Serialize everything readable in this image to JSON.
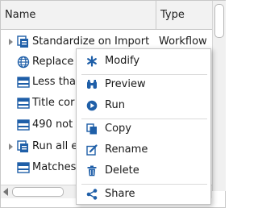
{
  "columns": {
    "name": "Name",
    "type": "Type"
  },
  "rows": [
    {
      "label": "Standardize on Import",
      "type": "Workflow",
      "icon": "workflow-icon",
      "expandable": true
    },
    {
      "label": "Replace",
      "type": "",
      "icon": "globe-icon",
      "expandable": false
    },
    {
      "label": "Less tha",
      "type": "",
      "icon": "rule-icon",
      "expandable": false
    },
    {
      "label": "Title cor",
      "type": "",
      "icon": "rule-icon",
      "expandable": false
    },
    {
      "label": "490 not",
      "type": "",
      "icon": "rule-icon",
      "expandable": false
    },
    {
      "label": "Run all e",
      "type": "",
      "icon": "workflow-icon",
      "expandable": true
    },
    {
      "label": "Matches",
      "type": "",
      "icon": "rule-icon",
      "expandable": false
    }
  ],
  "context_menu": {
    "items": [
      {
        "label": "Modify",
        "icon": "asterisk-icon"
      },
      {
        "label": "Preview",
        "icon": "binoculars-icon"
      },
      {
        "label": "Run",
        "icon": "play-circle-icon"
      },
      {
        "label": "Copy",
        "icon": "copy-icon"
      },
      {
        "label": "Rename",
        "icon": "edit-icon"
      },
      {
        "label": "Delete",
        "icon": "trash-icon"
      },
      {
        "label": "Share",
        "icon": "share-icon"
      }
    ]
  },
  "colors": {
    "icon": "#1f5fa8",
    "border": "#c8c8c8",
    "header_bg": "#f2f2f2"
  }
}
